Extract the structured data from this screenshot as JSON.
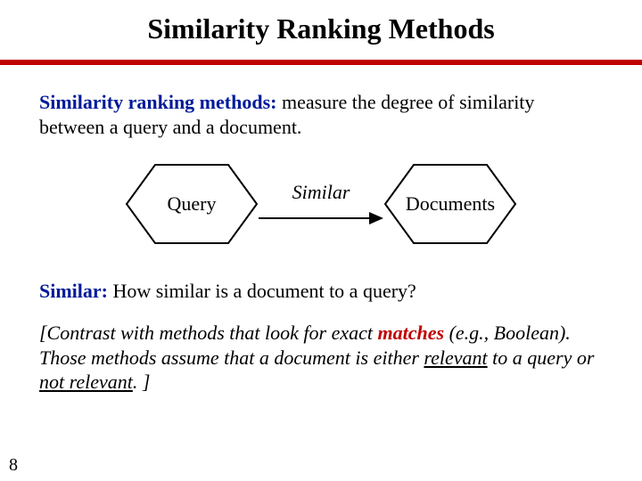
{
  "title": "Similarity Ranking Methods",
  "definition": {
    "term": "Similarity ranking methods:",
    "body": " measure the degree of similarity between a query and a document."
  },
  "diagram": {
    "left_label": "Query",
    "arrow_label": "Similar",
    "right_label": "Documents"
  },
  "question": {
    "term": "Similar:",
    "body": " How similar is a document to a query?"
  },
  "contrast": {
    "pre": "[Contrast with methods that look for exact ",
    "em": "matches",
    "mid": " (e.g., Boolean).  Those methods assume that a document is either ",
    "ul1": "relevant",
    "mid2": " to a query or ",
    "ul2": "not relevant",
    "post": ". ]"
  },
  "page_number": "8"
}
